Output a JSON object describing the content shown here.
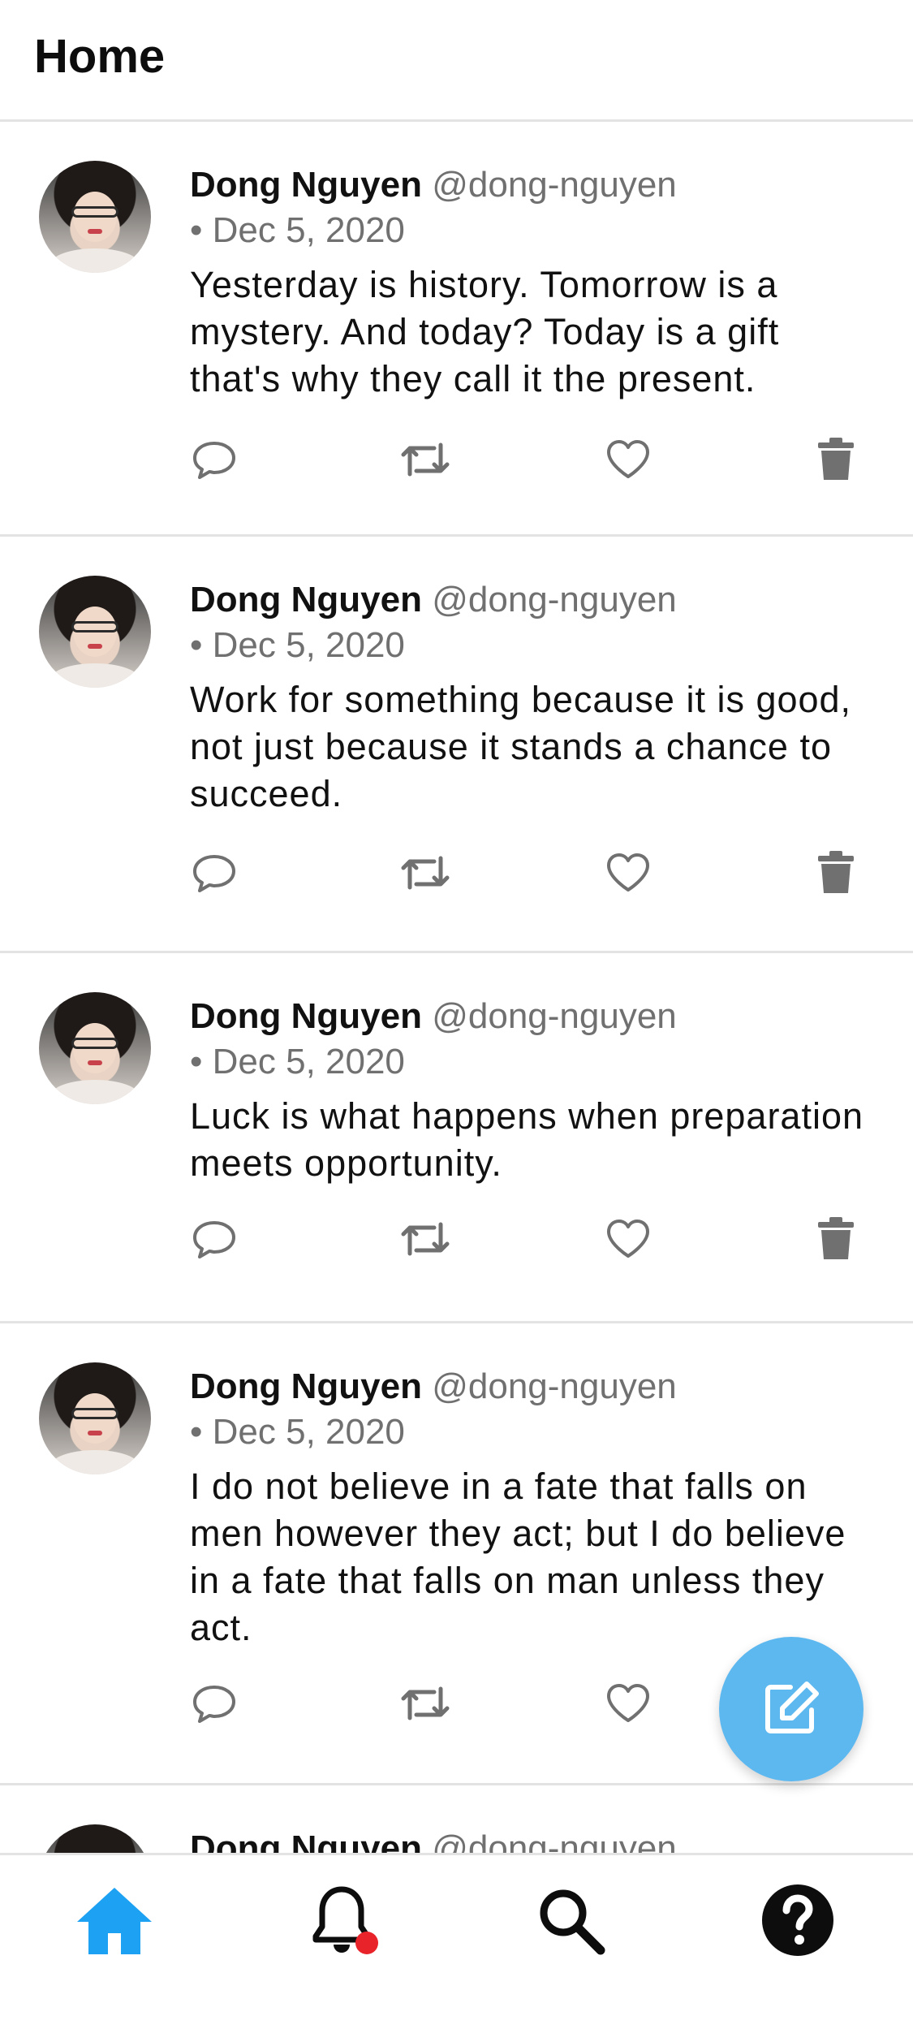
{
  "header": {
    "title": "Home"
  },
  "tweets": [
    {
      "name": "Dong Nguyen",
      "handle": "@dong-nguyen",
      "date": "• Dec 5, 2020",
      "text": "Yesterday is history. Tomorrow is a mystery. And today? Today is a gift that's why they call it the present."
    },
    {
      "name": "Dong Nguyen",
      "handle": "@dong-nguyen",
      "date": "• Dec 5, 2020",
      "text": "Work for something because it is good, not just because it stands a chance to succeed."
    },
    {
      "name": "Dong Nguyen",
      "handle": "@dong-nguyen",
      "date": "• Dec 5, 2020",
      "text": "Luck is what happens when preparation meets opportunity."
    },
    {
      "name": "Dong Nguyen",
      "handle": "@dong-nguyen",
      "date": "• Dec 5, 2020",
      "text": "I do not believe in a fate that falls on men however they act; but I do believe in a fate that falls on man unless they act."
    },
    {
      "name": "Dong Nguyen",
      "handle": "@dong-nguyen",
      "date": "",
      "text": ""
    }
  ],
  "actions": {
    "icons": [
      "reply-icon",
      "retweet-icon",
      "like-icon",
      "delete-icon"
    ]
  },
  "fab": {
    "icon": "compose-icon"
  },
  "bottom_nav": {
    "items": [
      {
        "icon": "home-icon",
        "active": true
      },
      {
        "icon": "bell-icon",
        "badge": true
      },
      {
        "icon": "search-icon"
      },
      {
        "icon": "help-icon"
      }
    ]
  },
  "colors": {
    "accent": "#1da1f2",
    "fab": "#5db8f0",
    "badge": "#e8232a",
    "muted": "#707070"
  }
}
